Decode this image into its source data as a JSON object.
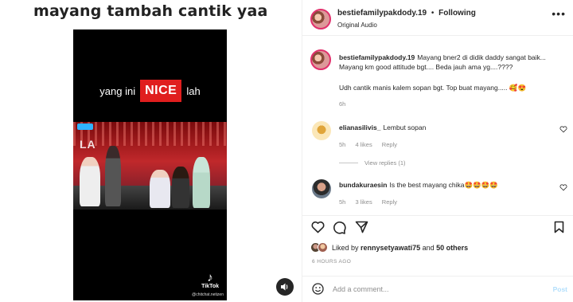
{
  "media": {
    "overlay_text": "mayang tambah cantik yaa",
    "caption_left": "yang ini",
    "caption_highlight": "NICE",
    "caption_right": "lah",
    "stage_sign": "LA",
    "watermark": "TikTok",
    "watermark_user": "@chitchat.netizen",
    "audio_icon": "speaker-icon"
  },
  "header": {
    "username": "bestiefamilypakdody.19",
    "separator": "•",
    "follow_status": "Following",
    "audio_label": "Original Audio",
    "more_icon": "more-horizontal-icon"
  },
  "caption": {
    "username": "bestiefamilypakdody.19",
    "text": "Mayang bner2 di didik daddy sangat baik... Mayang km good attitude bgt.... Beda jauh ama yg....????",
    "text2": "Udh cantik manis kalem sopan bgt. Top buat mayang..... 🥰😍",
    "time": "6h"
  },
  "comments": [
    {
      "username": "elianasilivis_",
      "text": "Lembut sopan",
      "time": "5h",
      "likes": "4 likes",
      "reply": "Reply",
      "view_replies": "View replies (1)"
    },
    {
      "username": "bundakuraesin",
      "text": "Is the best mayang chika🤩🤩🤩🤩",
      "time": "5h",
      "likes": "3 likes",
      "reply": "Reply"
    }
  ],
  "likes": {
    "prefix": "Liked by",
    "user": "rennysetyawati75",
    "conj": "and",
    "others": "50 others"
  },
  "timestamp": "6 HOURS AGO",
  "add_comment": {
    "placeholder": "Add a comment...",
    "post_label": "Post"
  },
  "colors": {
    "accent": "#e01e1e",
    "link_disabled": "#b2dffc",
    "muted": "#8e8e8e"
  }
}
